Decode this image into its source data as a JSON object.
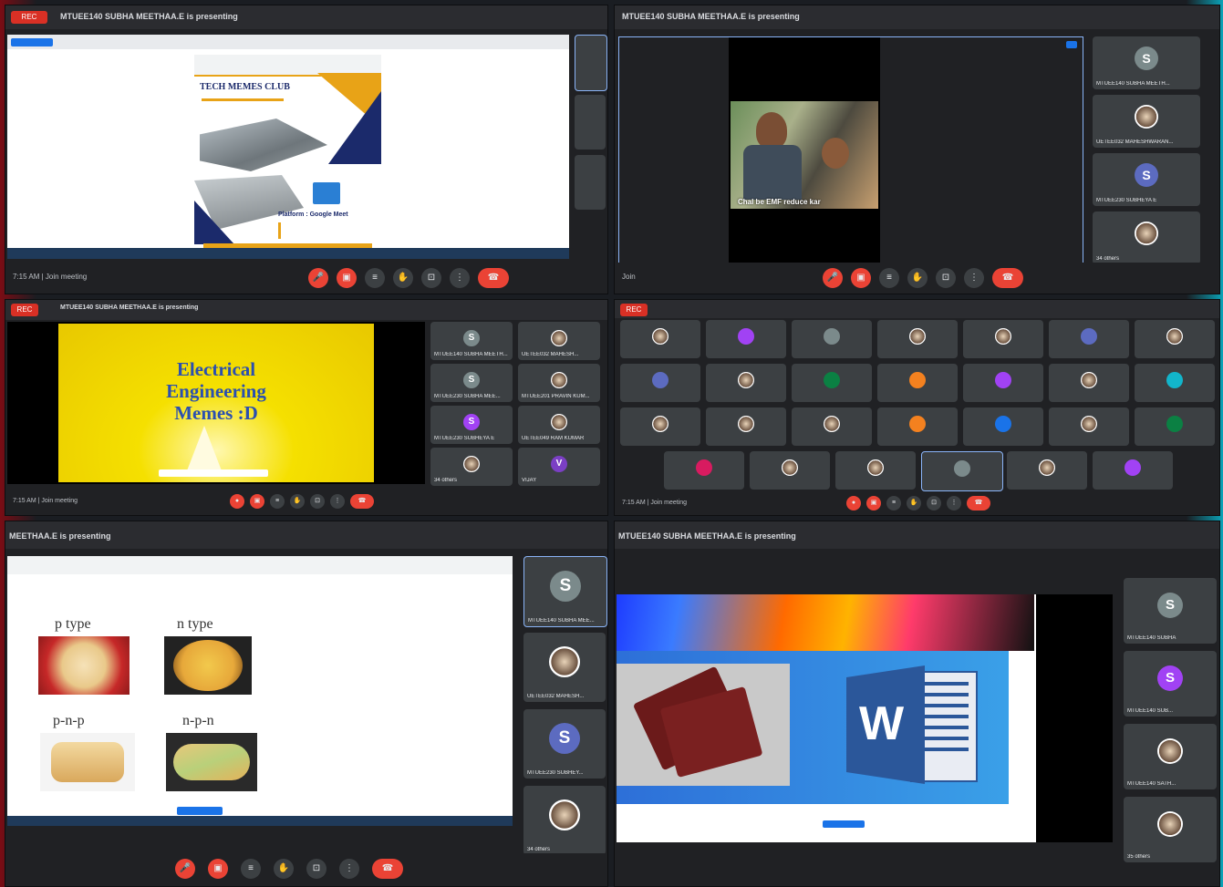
{
  "panels": {
    "p1": {
      "presenter": "MTUEE140 SUBHA MEETHAA.E is presenting",
      "poster_title": "TECH MEMES CLUB",
      "poster_platform": "Platform : Google Meet",
      "meta": "7:15 AM | Join meeting",
      "rec": "REC"
    },
    "p2": {
      "presenter": "MTUEE140 SUBHA MEETHAA.E is presenting",
      "meme_caption": "Chal be EMF reduce kar",
      "meta": "Join",
      "tiles": [
        {
          "initial": "S",
          "name": "MTUEE140 SUBHA MEETH..."
        },
        {
          "initial": "",
          "name": "UETEE032 MAHESHWARAN..."
        },
        {
          "initial": "S",
          "name": "MTUEE230 SUBHEYA E"
        },
        {
          "initial": "",
          "name": "34 others"
        }
      ]
    },
    "p3": {
      "presenter": "MTUEE140 SUBHA MEETHAA.E is presenting",
      "slide_line1": "Electrical",
      "slide_line2": "Engineering",
      "slide_line3": "Memes :D",
      "meta": "7:15 AM | Join meeting",
      "tiles": [
        {
          "initial": "S",
          "name": "MTUEE140 SUBHA MEETH..."
        },
        {
          "initial": "",
          "name": "UETEE032 MAHESH..."
        },
        {
          "initial": "S",
          "name": "MTUEE230 SUBHA MEE..."
        },
        {
          "initial": "",
          "name": "MTUEE201 PRAVIN KUM..."
        },
        {
          "initial": "S",
          "name": "MTUEE230 SUBHEYA E"
        },
        {
          "initial": "",
          "name": "UETEE049 RAM KUMAR"
        },
        {
          "initial": "",
          "name": "34 others"
        },
        {
          "initial": "V",
          "name": "VIJAY"
        }
      ]
    },
    "p4": {
      "rec": "REC",
      "meta": "7:15 AM | Join meeting",
      "grid": [
        {
          "initial": "",
          "color": "#5f6368"
        },
        {
          "initial": "V",
          "color": "#a142f4"
        },
        {
          "initial": "S",
          "color": "#7b8a8b"
        },
        {
          "initial": "",
          "color": "#5f6368"
        },
        {
          "initial": "",
          "color": "#5f6368"
        },
        {
          "initial": "S",
          "color": "#5c6bc0"
        },
        {
          "initial": "",
          "color": "#5f6368"
        },
        {
          "initial": "N",
          "color": "#5c6bc0"
        },
        {
          "initial": "",
          "color": "#5f6368"
        },
        {
          "initial": "R",
          "color": "#0b8043"
        },
        {
          "initial": "V",
          "color": "#f4811f"
        },
        {
          "initial": "V",
          "color": "#a142f4"
        },
        {
          "initial": "",
          "color": "#5f6368"
        },
        {
          "initial": "P",
          "color": "#12b5cb"
        },
        {
          "initial": "",
          "color": "#5f6368"
        },
        {
          "initial": "",
          "color": "#5f6368"
        },
        {
          "initial": "",
          "color": "#5f6368"
        },
        {
          "initial": "M",
          "color": "#f4811f"
        },
        {
          "initial": "N",
          "color": "#1a73e8"
        },
        {
          "initial": "",
          "color": "#5f6368"
        },
        {
          "initial": "S",
          "color": "#0b8043"
        },
        {
          "initial": "V",
          "color": "#d81b60"
        },
        {
          "initial": "",
          "color": "#5f6368"
        },
        {
          "initial": "",
          "color": "#5f6368"
        },
        {
          "initial": "S",
          "color": "#7b8a8b"
        },
        {
          "initial": "",
          "color": "#5f6368"
        },
        {
          "initial": "V",
          "color": "#a142f4"
        }
      ]
    },
    "p5": {
      "presenter": "MEETHAA.E is presenting",
      "labels": [
        "p type",
        "n type",
        "p-n-p",
        "n-p-n"
      ],
      "tiles": [
        {
          "initial": "S",
          "name": "MTUEE140 SUBHA MEE..."
        },
        {
          "initial": "",
          "name": "UETEE032 MAHESH..."
        },
        {
          "initial": "S",
          "name": "MTUEE230 SUBHEY..."
        },
        {
          "initial": "",
          "name": "34 others"
        }
      ]
    },
    "p6": {
      "presenter": "MTUEE140 SUBHA MEETHAA.E is presenting",
      "word_letter": "W",
      "tiles": [
        {
          "initial": "S",
          "name": "MTUEE140 SUBHA"
        },
        {
          "initial": "S",
          "name": "MTUEE140 SUB..."
        },
        {
          "initial": "",
          "name": "MTUEE140 SATH..."
        },
        {
          "initial": "",
          "name": "35 others"
        }
      ]
    }
  }
}
